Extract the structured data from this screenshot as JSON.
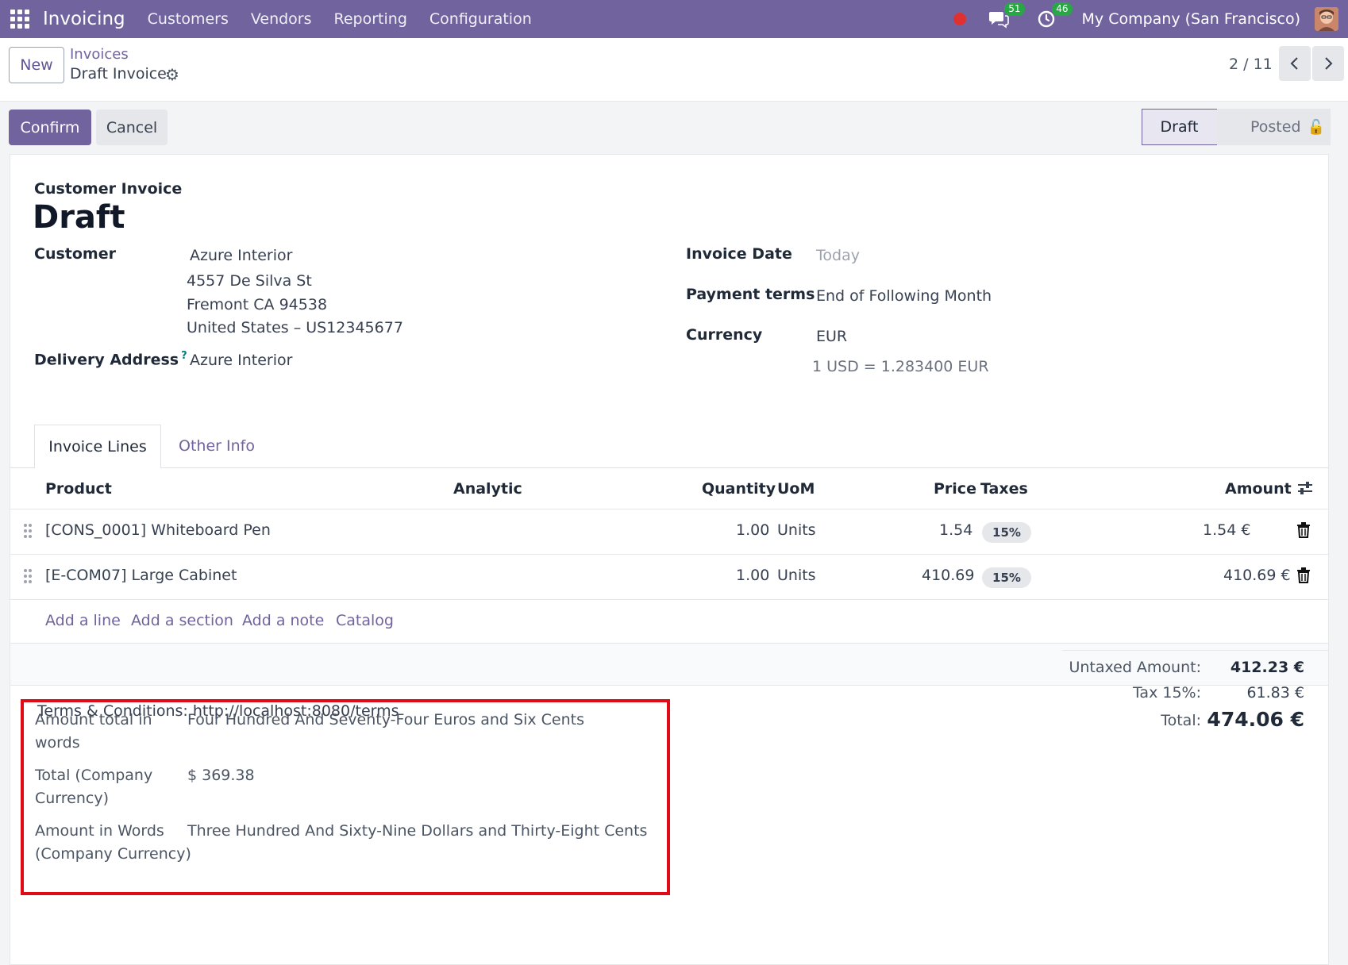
{
  "navbar": {
    "app_name": "Invoicing",
    "menu": [
      "Customers",
      "Vendors",
      "Reporting",
      "Configuration"
    ],
    "chat_count": "51",
    "activity_count": "46",
    "company": "My Company (San Francisco)"
  },
  "control": {
    "new_label": "New",
    "breadcrumb_parent": "Invoices",
    "breadcrumb_current": "Draft Invoice",
    "pager": "2 / 11"
  },
  "actions": {
    "confirm": "Confirm",
    "cancel": "Cancel"
  },
  "status": {
    "draft": "Draft",
    "posted": "Posted"
  },
  "header": {
    "type": "Customer Invoice",
    "name": "Draft"
  },
  "fields": {
    "customer_label": "Customer",
    "customer_name": "Azure Interior",
    "customer_address": [
      "4557 De Silva St",
      "Fremont CA 94538",
      "United States – US12345677"
    ],
    "delivery_label": "Delivery Address",
    "delivery_help": "?",
    "delivery_value": "Azure Interior",
    "invoice_date_label": "Invoice Date",
    "invoice_date_placeholder": "Today",
    "payment_terms_label": "Payment terms",
    "payment_terms_value": "End of Following Month",
    "currency_label": "Currency",
    "currency_value": "EUR",
    "rate": "1 USD = 1.283400 EUR"
  },
  "tabs": [
    "Invoice Lines",
    "Other Info"
  ],
  "lines": {
    "headers": {
      "product": "Product",
      "analytic": "Analytic",
      "quantity": "Quantity",
      "uom": "UoM",
      "price": "Price",
      "taxes": "Taxes",
      "amount": "Amount"
    },
    "rows": [
      {
        "product": "[CONS_0001] Whiteboard Pen",
        "quantity": "1.00",
        "uom": "Units",
        "price": "1.54",
        "tax": "15%",
        "amount": "1.54 €"
      },
      {
        "product": "[E-COM07] Large Cabinet",
        "quantity": "1.00",
        "uom": "Units",
        "price": "410.69",
        "tax": "15%",
        "amount": "410.69 €"
      }
    ],
    "add_links": [
      "Add a line",
      "Add a section",
      "Add a note",
      "Catalog"
    ]
  },
  "terms": "Terms & Conditions: http://localhost:8080/terms",
  "totals": {
    "untaxed_label": "Untaxed Amount:",
    "untaxed_value": "412.23 €",
    "tax_label": "Tax 15%:",
    "tax_value": "61.83 €",
    "total_label": "Total:",
    "total_value": "474.06 €"
  },
  "words": {
    "amount_words_label": "Amount total in words",
    "amount_words_value": "Four Hundred And Seventy-Four Euros and Six Cents",
    "company_total_label": "Total (Company Currency)",
    "company_total_value": "$ 369.38",
    "company_words_label": "Amount in Words (Company Currency)",
    "company_words_value": "Three Hundred And Sixty-Nine Dollars and Thirty-Eight Cents"
  },
  "colors": {
    "brand": "#71639e",
    "highlight_box": "#e10b17",
    "badge_green": "#28a745"
  }
}
